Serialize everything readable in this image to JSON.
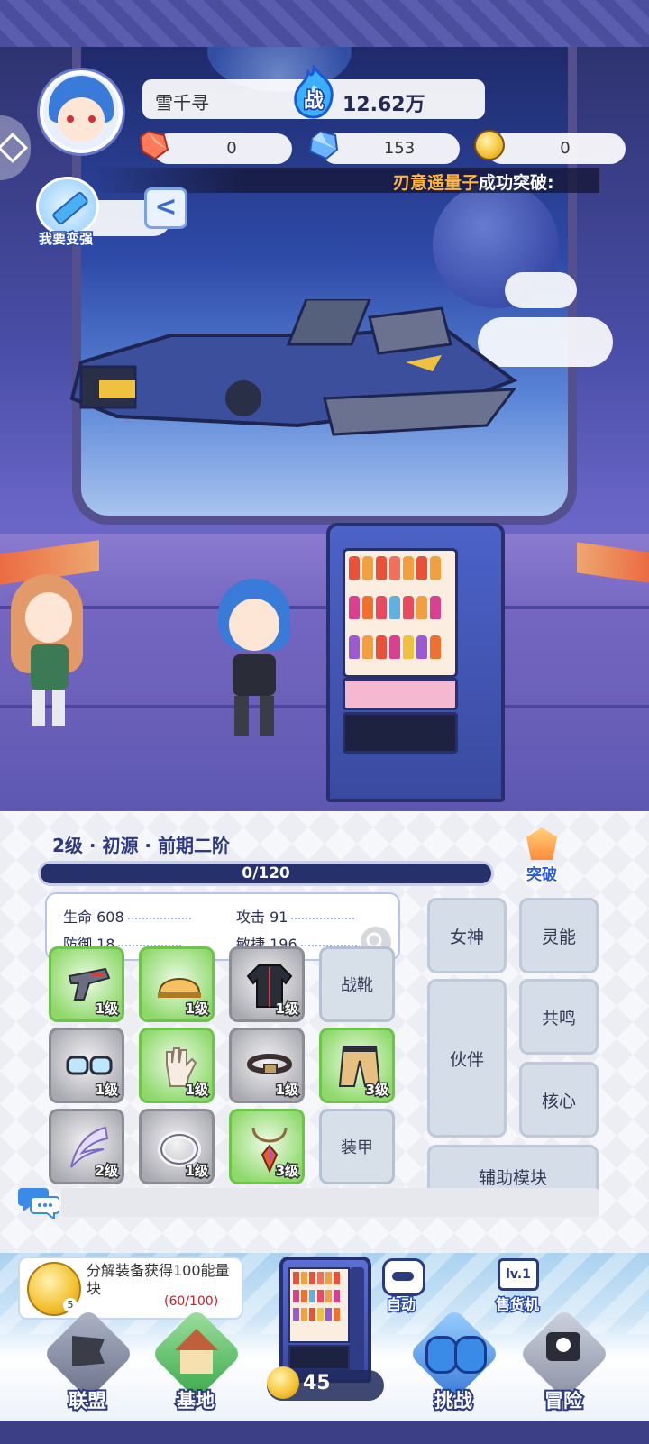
{
  "player": {
    "name": "雪千寻",
    "power_label": "战",
    "power_value": "12.62万"
  },
  "resources": [
    {
      "icon": "red-crystal-icon",
      "value": "0"
    },
    {
      "icon": "blue-diamond-icon",
      "value": "153"
    },
    {
      "icon": "gold-coin-icon",
      "value": "0"
    }
  ],
  "ticker": {
    "name": "刃意遥量子",
    "message": "成功突破:"
  },
  "strong_button": {
    "label": "我要变强"
  },
  "back_button": {
    "label": "<"
  },
  "level": {
    "rank": "2级 · 初源 · 前期二阶",
    "xp": "0/120",
    "xp_fraction": 0.0,
    "breakthrough_label": "突破"
  },
  "stats": [
    {
      "label": "生命 608"
    },
    {
      "label": "攻击 91"
    },
    {
      "label": "防御 18"
    },
    {
      "label": "敏捷 196"
    }
  ],
  "equipment": [
    {
      "item": "pistol-icon",
      "level": "1级",
      "rarity": "green"
    },
    {
      "item": "helmet-icon",
      "level": "1级",
      "rarity": "green"
    },
    {
      "item": "jacket-icon",
      "level": "1级",
      "rarity": "gray"
    },
    {
      "slot_label": "战靴"
    },
    {
      "item": "goggles-icon",
      "level": "1级",
      "rarity": "gray"
    },
    {
      "item": "glove-icon",
      "level": "1级",
      "rarity": "green"
    },
    {
      "item": "belt-icon",
      "level": "1级",
      "rarity": "gray"
    },
    {
      "item": "pants-icon",
      "level": "3级",
      "rarity": "green"
    },
    {
      "item": "wing-icon",
      "level": "2级",
      "rarity": "gray"
    },
    {
      "item": "ring-icon",
      "level": "1级",
      "rarity": "gray"
    },
    {
      "item": "necklace-icon",
      "level": "3级",
      "rarity": "green"
    },
    {
      "slot_label": "装甲"
    }
  ],
  "feature_buttons": {
    "goddess": "女神",
    "psionic": "灵能",
    "partner": "伙伴",
    "resonance": "共鸣",
    "core": "核心",
    "assist_module": "辅助模块"
  },
  "task": {
    "text": "分解装备获得100能量块",
    "progress": "(60/100)",
    "badge": "5"
  },
  "vending": {
    "coin_count": "45",
    "auto_label": "自动",
    "machine_level": "lv.1",
    "machine_label": "售货机"
  },
  "nav": [
    {
      "label": "联盟",
      "icon": "alliance-flag-icon"
    },
    {
      "label": "基地",
      "icon": "base-house-icon"
    },
    {
      "label": "挑战",
      "icon": "boxing-gloves-icon"
    },
    {
      "label": "冒险",
      "icon": "pirate-flag-icon"
    }
  ]
}
